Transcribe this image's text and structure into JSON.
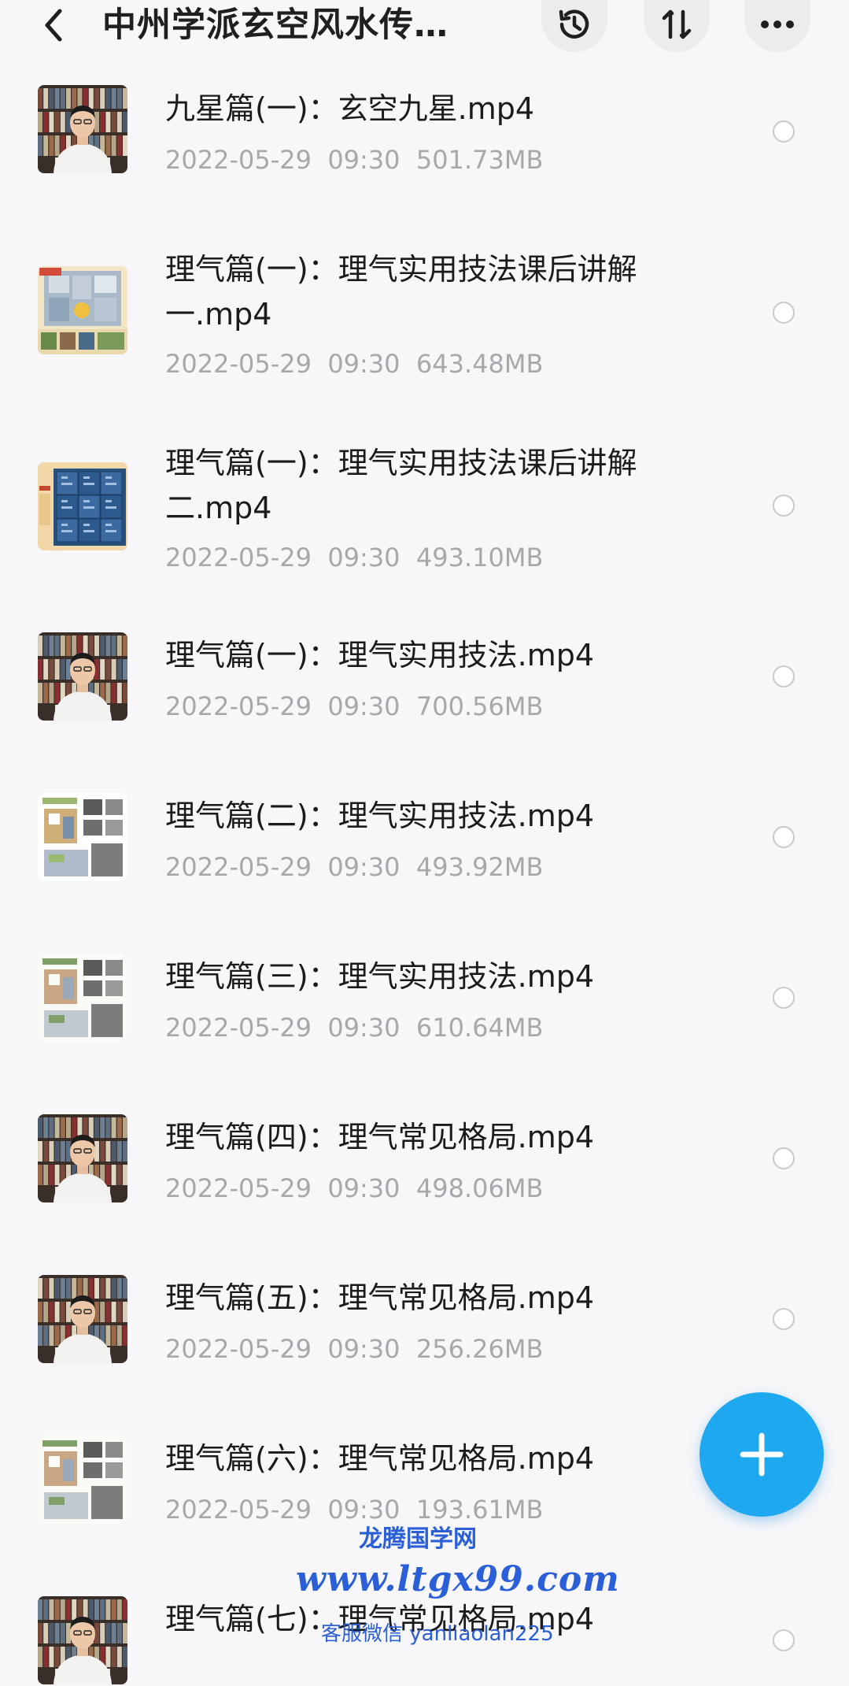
{
  "header": {
    "title": "中州学派玄空风水传…",
    "back_icon": "chevron-left-icon",
    "history_icon": "history-clock-icon",
    "sort_icon": "sort-arrows-icon",
    "more_icon": "more-dots-icon"
  },
  "files": [
    {
      "name": "九星篇(一)：玄空九星.mp4",
      "date": "2022-05-29",
      "time": "09:30",
      "size": "501.73MB",
      "thumb": "video-person"
    },
    {
      "name": "理气篇(一)：理气实用技法课后讲解一.mp4",
      "date": "2022-05-29",
      "time": "09:30",
      "size": "643.48MB",
      "thumb": "floor-plan"
    },
    {
      "name": "理气篇(一)：理气实用技法课后讲解二.mp4",
      "date": "2022-05-29",
      "time": "09:30",
      "size": "493.10MB",
      "thumb": "blue-grid"
    },
    {
      "name": "理气篇(一)：理气实用技法.mp4",
      "date": "2022-05-29",
      "time": "09:30",
      "size": "700.56MB",
      "thumb": "video-person"
    },
    {
      "name": "理气篇(二)：理气实用技法.mp4",
      "date": "2022-05-29",
      "time": "09:30",
      "size": "493.92MB",
      "thumb": "slide-doc"
    },
    {
      "name": "理气篇(三)：理气实用技法.mp4",
      "date": "2022-05-29",
      "time": "09:30",
      "size": "610.64MB",
      "thumb": "slide-doc"
    },
    {
      "name": "理气篇(四)：理气常见格局.mp4",
      "date": "2022-05-29",
      "time": "09:30",
      "size": "498.06MB",
      "thumb": "video-person"
    },
    {
      "name": "理气篇(五)：理气常见格局.mp4",
      "date": "2022-05-29",
      "time": "09:30",
      "size": "256.26MB",
      "thumb": "video-person"
    },
    {
      "name": "理气篇(六)：理气常见格局.mp4",
      "date": "2022-05-29",
      "time": "09:30",
      "size": "193.61MB",
      "thumb": "slide-doc"
    },
    {
      "name": "理气篇(七)：理气常见格局.mp4",
      "date": "",
      "time": "",
      "size": "",
      "thumb": "video-person"
    }
  ],
  "fab": {
    "icon": "plus-icon"
  },
  "watermark": {
    "line1": "龙腾国学网",
    "line2": "www.ltgx99.com",
    "line3": "客服微信 yanliaolan225"
  },
  "colors": {
    "accent": "#1ea8f0",
    "watermark": "#2a5fd8",
    "meta": "#a8a8ac"
  }
}
